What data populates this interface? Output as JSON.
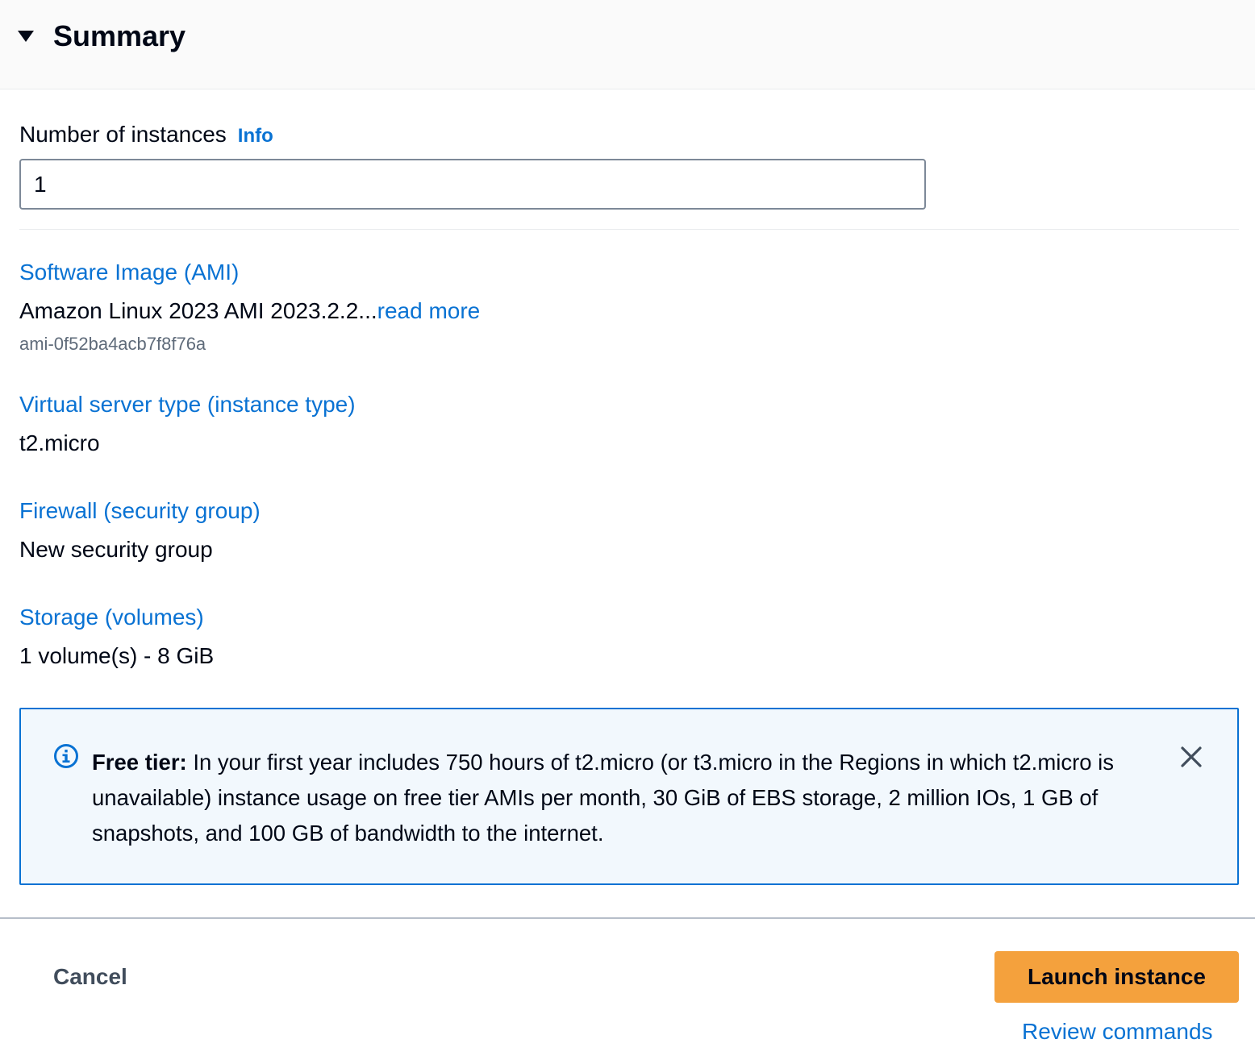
{
  "header": {
    "title": "Summary",
    "caret_icon": "caret-down-icon"
  },
  "instances": {
    "label": "Number of instances",
    "info_link": "Info",
    "value": "1"
  },
  "sections": {
    "ami": {
      "title": "Software Image (AMI)",
      "value": "Amazon Linux 2023 AMI 2023.2.2...",
      "read_more": "read more",
      "sub": "ami-0f52ba4acb7f8f76a"
    },
    "instance_type": {
      "title": "Virtual server type (instance type)",
      "value": "t2.micro"
    },
    "firewall": {
      "title": "Firewall (security group)",
      "value": "New security group"
    },
    "storage": {
      "title": "Storage (volumes)",
      "value": "1 volume(s) - 8 GiB"
    }
  },
  "alert": {
    "bold": "Free tier:",
    "text": " In your first year includes 750 hours of t2.micro (or t3.micro in the Regions in which t2.micro is unavailable) instance usage on free tier AMIs per month, 30 GiB of EBS storage, 2 million IOs, 1 GB of snapshots, and 100 GB of bandwidth to the internet.",
    "icon": "info-circle-icon",
    "close_icon": "close-icon"
  },
  "footer": {
    "cancel_label": "Cancel",
    "launch_label": "Launch instance",
    "review_label": "Review commands"
  },
  "colors": {
    "link": "#0972d3",
    "primary_button": "#f4a13d",
    "alert_background": "#f2f8fd",
    "alert_border": "#0972d3",
    "text": "#000716",
    "muted_text": "#5f6b7a"
  }
}
